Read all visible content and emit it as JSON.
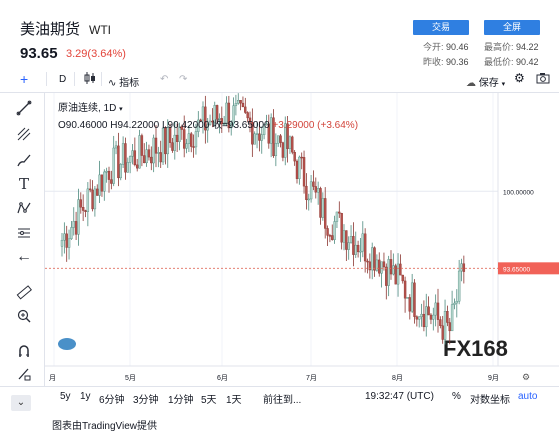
{
  "header": {
    "title": "美油期货",
    "symbol": "WTI",
    "price": "93.65",
    "change": "3.29(3.64%)",
    "btn_left": "交易",
    "btn_right": "全屏",
    "stats": {
      "open_label": "今开:",
      "open": "90.46",
      "high_label": "最高价:",
      "high": "94.22",
      "prev_label": "昨收:",
      "prev": "90.36",
      "low_label": "最低价:",
      "low": "90.42"
    }
  },
  "toolbar": {
    "interval": "D",
    "indicators": "指标",
    "save": "保存"
  },
  "legend": {
    "name": "原油连续, 1D",
    "open": "O90.46000",
    "high": "H94.22000",
    "low": "L90.42000",
    "close": "收=93.65000",
    "change": "+3.29000 (+3.64%)"
  },
  "price_axis": {
    "label_100": "100.00000",
    "current": "93.65000"
  },
  "watermark": "FX168",
  "bottom": {
    "ranges": [
      "5y",
      "1y",
      "6分钟",
      "3分钟",
      "1分钟",
      "5天",
      "1天"
    ],
    "goto": "前往到...",
    "time": "19:32:47 (UTC)",
    "percent": "%",
    "log": "对数坐标",
    "auto": "auto",
    "footer": "图表由TradingView提供"
  },
  "chart_data": {
    "type": "candlestick",
    "x_tick_labels": [
      "月",
      "5月",
      "6月",
      "7月",
      "8月",
      "9月"
    ],
    "y_tick_labels": [
      "100.00000"
    ],
    "current_price": 93.65,
    "colors": {
      "up": "#26a69a",
      "down": "#ef5350",
      "up_body": "#b7d7cf",
      "down_body": "#b5504b"
    }
  }
}
